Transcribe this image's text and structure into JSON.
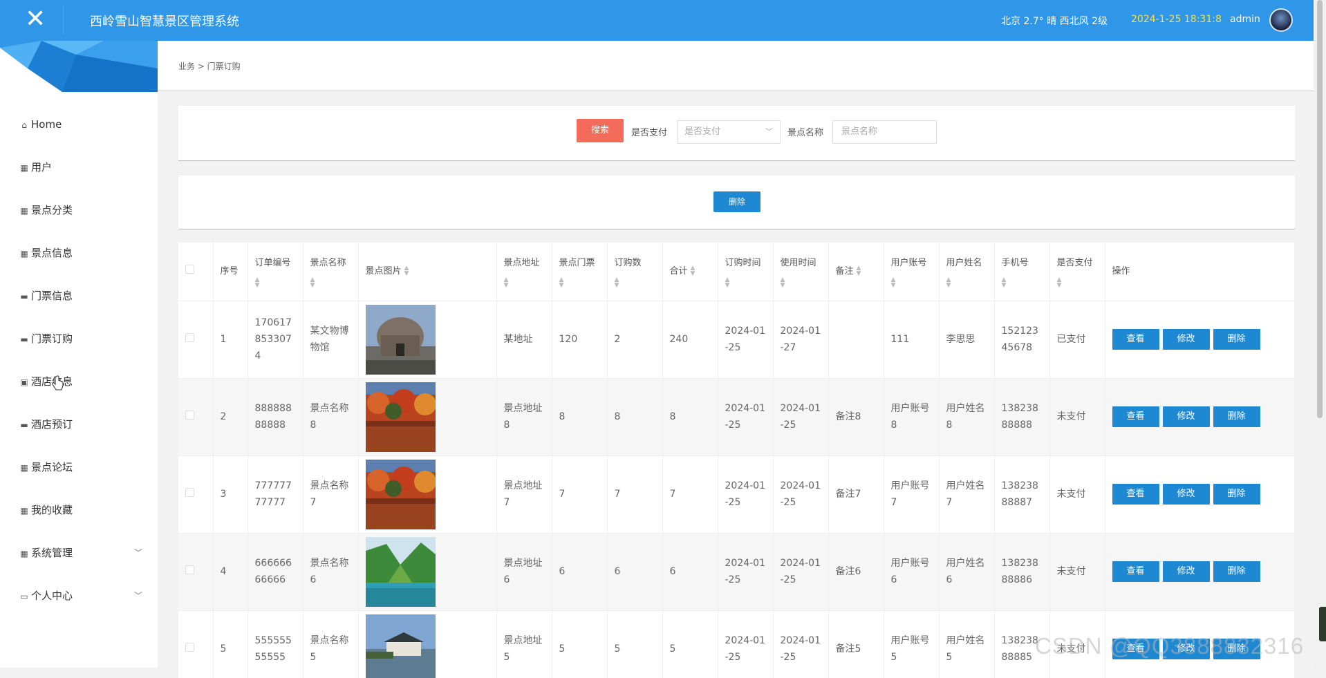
{
  "header": {
    "title": "西岭雪山智慧景区管理系统",
    "weather": "北京  2.7°  晴  西北风  2级",
    "datetime": "2024-1-25 18:31:8",
    "username": "admin",
    "close_icon": "✕"
  },
  "sidebar": {
    "items": [
      {
        "label": "Home",
        "icon": "home-icon",
        "glyph": "⌂"
      },
      {
        "label": "用户",
        "icon": "grid-icon",
        "glyph": "▦"
      },
      {
        "label": "景点分类",
        "icon": "grid-icon",
        "glyph": "▦"
      },
      {
        "label": "景点信息",
        "icon": "grid-icon",
        "glyph": "▦"
      },
      {
        "label": "门票信息",
        "icon": "briefcase-icon",
        "glyph": "▬"
      },
      {
        "label": "门票订购",
        "icon": "card-icon",
        "glyph": "▬"
      },
      {
        "label": "酒店信息",
        "icon": "chart-icon",
        "glyph": "▣"
      },
      {
        "label": "酒店预订",
        "icon": "card-icon",
        "glyph": "▬"
      },
      {
        "label": "景点论坛",
        "icon": "grid-icon",
        "glyph": "▦"
      },
      {
        "label": "我的收藏",
        "icon": "grid-icon",
        "glyph": "▦"
      },
      {
        "label": "系统管理",
        "icon": "grid-icon",
        "glyph": "▦",
        "chevron": "﹀"
      },
      {
        "label": "个人中心",
        "icon": "window-icon",
        "glyph": "▭",
        "chevron": "﹀"
      }
    ]
  },
  "breadcrumb": "业务  >  门票订购",
  "search": {
    "button": "搜索",
    "paid_label": "是否支付",
    "paid_placeholder": "是否支付",
    "name_label": "景点名称",
    "name_placeholder": "景点名称"
  },
  "actions": {
    "delete": "删除"
  },
  "table": {
    "columns": [
      "序号",
      "订单编号",
      "景点名称",
      "景点图片",
      "景点地址",
      "景点门票",
      "订购数",
      "合计",
      "订购时间",
      "使用时间",
      "备注",
      "用户账号",
      "用户姓名",
      "手机号",
      "是否支付",
      "操作"
    ],
    "buttons": {
      "view": "查看",
      "edit": "修改",
      "delete": "删除"
    },
    "rows": [
      {
        "no": "1",
        "order": "1706178533074",
        "name": "某文物博物馆",
        "image": "museum",
        "address": "某地址",
        "ticket": "120",
        "count": "2",
        "total": "240",
        "order_time": "2024-01-25",
        "use_time": "2024-01-27",
        "remark": "",
        "account": "111",
        "user_name": "李思思",
        "phone": "15212345678",
        "paid": "已支付"
      },
      {
        "no": "2",
        "order": "88888888888",
        "name": "景点名称8",
        "image": "autumn-lake",
        "address": "景点地址8",
        "ticket": "8",
        "count": "8",
        "total": "8",
        "order_time": "2024-01-25",
        "use_time": "2024-01-25",
        "remark": "备注8",
        "account": "用户账号8",
        "user_name": "用户姓名8",
        "phone": "13823888888",
        "paid": "未支付"
      },
      {
        "no": "3",
        "order": "77777777777",
        "name": "景点名称7",
        "image": "autumn-lake",
        "address": "景点地址7",
        "ticket": "7",
        "count": "7",
        "total": "7",
        "order_time": "2024-01-25",
        "use_time": "2024-01-25",
        "remark": "备注7",
        "account": "用户账号7",
        "user_name": "用户姓名7",
        "phone": "13823888887",
        "paid": "未支付"
      },
      {
        "no": "4",
        "order": "66666666666",
        "name": "景点名称6",
        "image": "green-valley",
        "address": "景点地址6",
        "ticket": "6",
        "count": "6",
        "total": "6",
        "order_time": "2024-01-25",
        "use_time": "2024-01-25",
        "remark": "备注6",
        "account": "用户账号6",
        "user_name": "用户姓名6",
        "phone": "13823888886",
        "paid": "未支付"
      },
      {
        "no": "5",
        "order": "55555555555",
        "name": "景点名称5",
        "image": "riverside-house",
        "address": "景点地址5",
        "ticket": "5",
        "count": "5",
        "total": "5",
        "order_time": "2024-01-25",
        "use_time": "2024-01-25",
        "remark": "备注5",
        "account": "用户账号5",
        "user_name": "用户姓名5",
        "phone": "13823888885",
        "paid": "未支付"
      }
    ]
  },
  "watermark": "CSDN @QQ3888832316",
  "colors": {
    "header": "#2f96e8",
    "primary_button": "#1f88d2",
    "search_button": "#f46a5b",
    "datetime": "#f6e04b"
  }
}
